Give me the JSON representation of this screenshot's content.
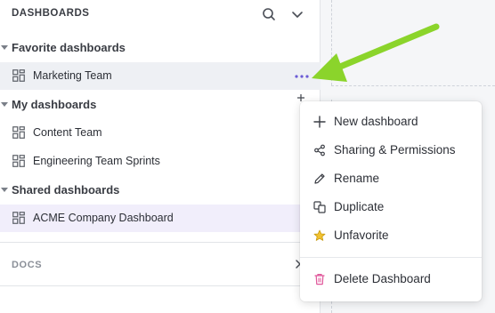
{
  "sidebar": {
    "title": "DASHBOARDS",
    "sections": [
      {
        "label": "Favorite dashboards",
        "items": [
          {
            "label": "Marketing Team"
          }
        ]
      },
      {
        "label": "My dashboards",
        "items": [
          {
            "label": "Content Team"
          },
          {
            "label": "Engineering Team Sprints"
          }
        ]
      },
      {
        "label": "Shared dashboards",
        "items": [
          {
            "label": "ACME Company Dashboard"
          }
        ]
      }
    ],
    "docs_label": "DOCS"
  },
  "context_menu": {
    "items": [
      {
        "label": "New dashboard",
        "icon": "plus-icon"
      },
      {
        "label": "Sharing & Permissions",
        "icon": "share-icon"
      },
      {
        "label": "Rename",
        "icon": "pencil-icon"
      },
      {
        "label": "Duplicate",
        "icon": "duplicate-icon"
      },
      {
        "label": "Unfavorite",
        "icon": "star-icon"
      }
    ],
    "danger_item": {
      "label": "Delete Dashboard",
      "icon": "trash-icon"
    }
  },
  "colors": {
    "accent": "#6b5bd6",
    "arrow": "#8bd42b",
    "danger_icon": "#e0569a",
    "star": "#f2c230"
  }
}
